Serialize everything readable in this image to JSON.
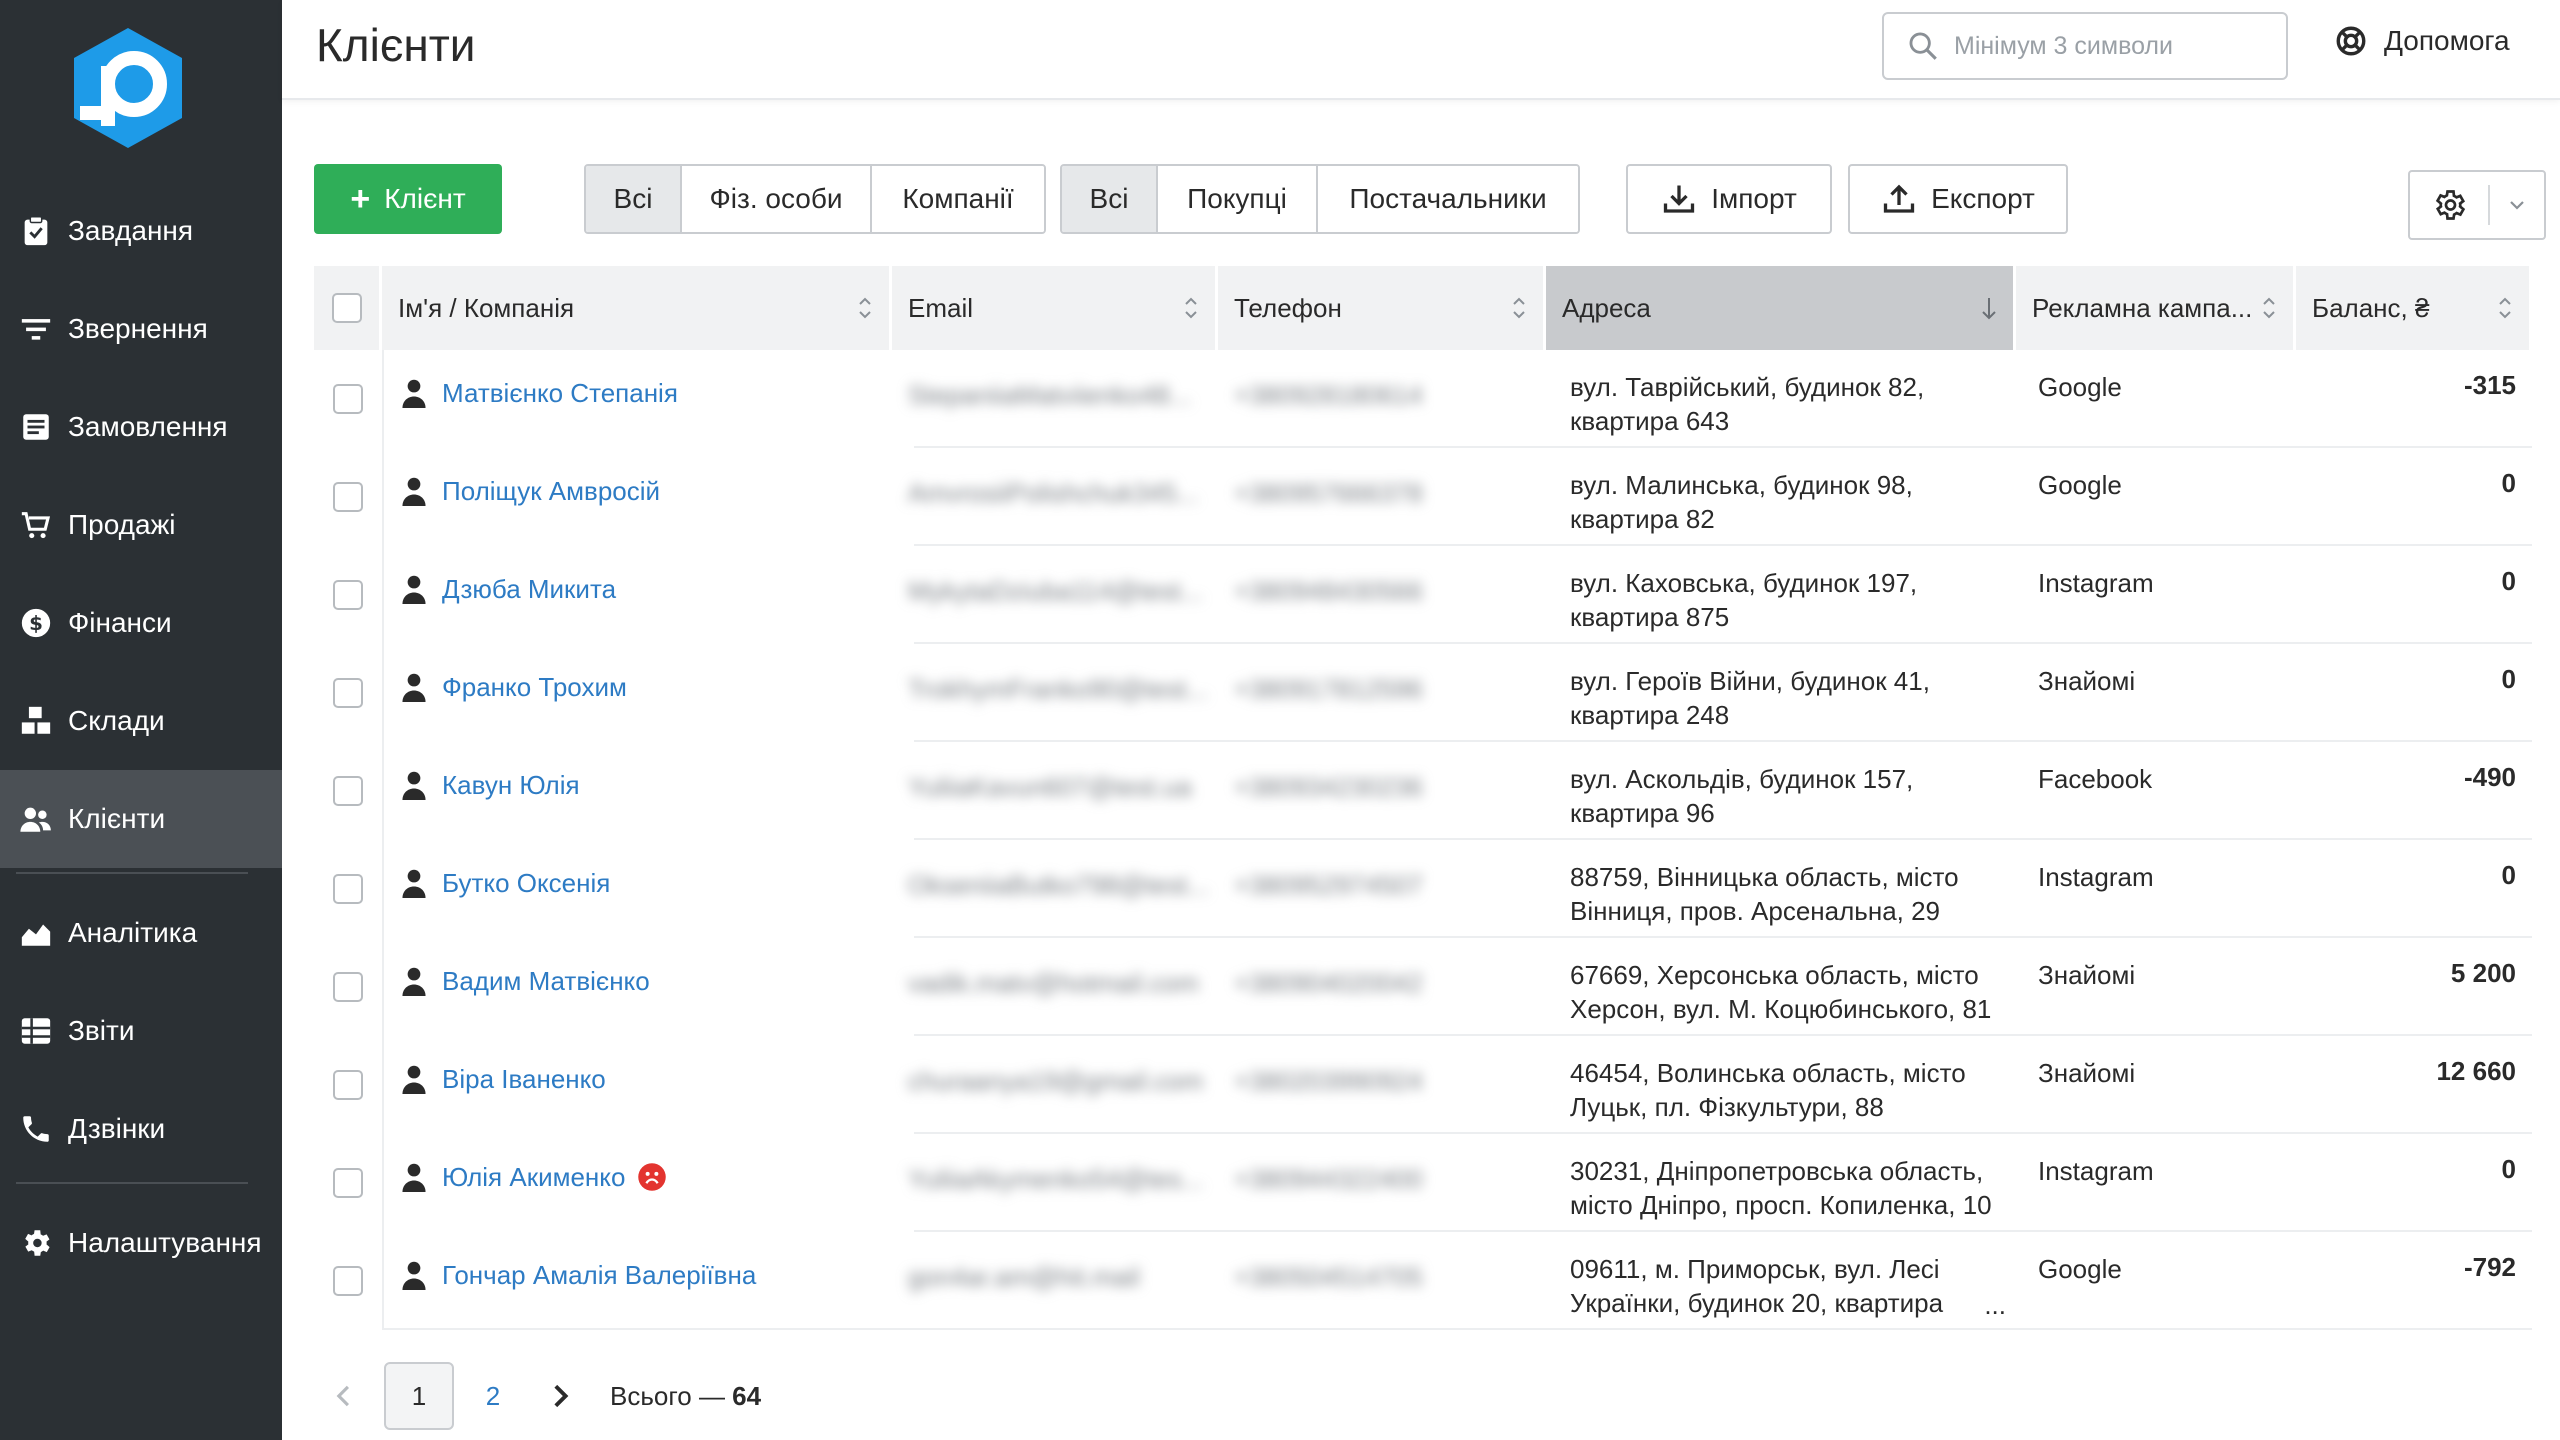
{
  "sidebar": {
    "items": [
      {
        "label": "Завдання",
        "icon": "clipboard-check-icon"
      },
      {
        "label": "Звернення",
        "icon": "filter-lines-icon"
      },
      {
        "label": "Замовлення",
        "icon": "receipt-icon"
      },
      {
        "label": "Продажі",
        "icon": "cart-icon"
      },
      {
        "label": "Фінанси",
        "icon": "dollar-circle-icon"
      },
      {
        "label": "Склади",
        "icon": "boxes-icon"
      },
      {
        "label": "Клієнти",
        "icon": "users-icon",
        "active": true
      },
      {
        "label": "Аналітика",
        "icon": "area-chart-icon"
      },
      {
        "label": "Звіти",
        "icon": "list-table-icon"
      },
      {
        "label": "Дзвінки",
        "icon": "phone-icon"
      },
      {
        "label": "Налаштування",
        "icon": "gear-icon"
      }
    ]
  },
  "header": {
    "title": "Клієнти",
    "search_placeholder": "Мінімум 3 символи",
    "help_label": "Допомога"
  },
  "toolbar": {
    "add_label": "Клієнт",
    "type_filter": [
      "Всі",
      "Фіз. особи",
      "Компанії"
    ],
    "role_filter": [
      "Всі",
      "Покупці",
      "Постачальники"
    ],
    "import_label": "Імпорт",
    "export_label": "Експорт"
  },
  "table": {
    "columns": [
      "Ім'я / Компанія",
      "Email",
      "Телефон",
      "Адреса",
      "Рекламна кампа...",
      "Баланс, ₴"
    ],
    "rows": [
      {
        "name": "Матвієнко Степанія",
        "email": "StepaniiaMatviienko48...",
        "phone": "+380928180614",
        "addr1": "вул. Таврійський, будинок 82,",
        "addr2": "квартира 643",
        "campaign": "Google",
        "balance": "-315",
        "sign": "neg"
      },
      {
        "name": "Поліщук Амвросій",
        "email": "AmvrosiiPolishchuk345...",
        "phone": "+380957666378",
        "addr1": "вул. Малинська, будинок 98,",
        "addr2": "квартира 82",
        "campaign": "Google",
        "balance": "0",
        "sign": "zero"
      },
      {
        "name": "Дзюба Микита",
        "email": "MykytaDziuba114@test...",
        "phone": "+380948430566",
        "addr1": "вул. Каховська, будинок 197,",
        "addr2": "квартира 875",
        "campaign": "Instagram",
        "balance": "0",
        "sign": "zero"
      },
      {
        "name": "Франко Трохим",
        "email": "TrokhymFranko90@test...",
        "phone": "+380917812596",
        "addr1": "вул. Героїв Війни, будинок 41,",
        "addr2": "квартира 248",
        "campaign": "Знайомі",
        "balance": "0",
        "sign": "zero"
      },
      {
        "name": "Кавун Юлія",
        "email": "YuliiaKavun607@test.ua",
        "phone": "+380934230236",
        "addr1": "вул. Аскольдів, будинок 157,",
        "addr2": "квартира 96",
        "campaign": "Facebook",
        "balance": "-490",
        "sign": "neg"
      },
      {
        "name": "Бутко Оксенія",
        "email": "OkseniiaButko798@test...",
        "phone": "+380952974507",
        "addr1": "88759, Вінницька область, місто",
        "addr2": "Вінниця, пров. Арсенальна, 29",
        "campaign": "Instagram",
        "balance": "0",
        "sign": "zero"
      },
      {
        "name": "Вадим Матвієнко",
        "email": "vadik.matv@hotmail.com",
        "phone": "+380904020042",
        "addr1": "67669, Херсонська область, місто",
        "addr2": "Херсон, вул. М. Коцюбинського, 81",
        "campaign": "Знайомі",
        "balance": "5 200",
        "sign": "pos"
      },
      {
        "name": "Віра Іваненко",
        "email": "churaanya19@gmail.com",
        "phone": "+380203990924",
        "addr1": "46454, Волинська область, місто",
        "addr2": "Луцьк, пл. Фізкультури, 88",
        "campaign": "Знайомі",
        "balance": "12 660",
        "sign": "pos"
      },
      {
        "name": "Юлія Акименко",
        "email": "YuliiaAkymenko54@tes...",
        "phone": "+380944322400",
        "addr1": "30231, Дніпропетровська область,",
        "addr2": "місто Дніпро, просп. Копиленка, 10",
        "campaign": "Instagram",
        "balance": "0",
        "sign": "zero",
        "flag": "sad-face-icon"
      },
      {
        "name": "Гончар Амалія Валеріївна",
        "email": "gon4ar.am@hit.mail",
        "phone": "+380504514705",
        "addr1": "09611, м. Приморськ, вул. Лесі",
        "addr2": "Українки, будинок 20, квартира",
        "campaign": "Google",
        "balance": "-792",
        "sign": "neg",
        "ellipsis": "..."
      }
    ]
  },
  "pagination": {
    "current": "1",
    "next_page": "2",
    "total_label": "Всього — ",
    "total_value": "64"
  },
  "colors": {
    "sidebar_bg": "#2b3034",
    "sidebar_active": "#4b5055",
    "accent_green": "#2fae58",
    "link_blue": "#2d7bc4",
    "negative_red": "#e3342f",
    "logo_blue": "#1e9be8"
  }
}
